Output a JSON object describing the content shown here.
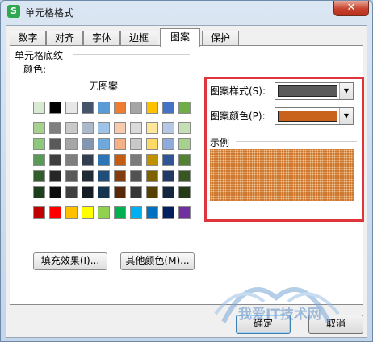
{
  "window": {
    "title": "单元格格式",
    "app_icon_letter": "S",
    "close_glyph": "✕"
  },
  "tabs": [
    {
      "label": "数字",
      "active": false
    },
    {
      "label": "对齐",
      "active": false
    },
    {
      "label": "字体",
      "active": false
    },
    {
      "label": "边框",
      "active": false
    },
    {
      "label": "图案",
      "active": true
    },
    {
      "label": "保护",
      "active": false
    }
  ],
  "shading": {
    "section_title": "单元格底纹",
    "color_label": "颜色:",
    "no_pattern_label": "无图案",
    "palette_rows": [
      [
        "#d9ead3",
        "#000000",
        "#e7e7e7",
        "#44546a",
        "#5b9bd5",
        "#ed7d31",
        "#a5a5a5",
        "#ffc000",
        "#4472c4",
        "#70ad47"
      ],
      [
        "#a9d18e",
        "#7f7f7f",
        "#c9c9c9",
        "#acb9ca",
        "#9dc3e6",
        "#f8cbad",
        "#dbdbdb",
        "#ffe699",
        "#b4c7e7",
        "#c5e0b4"
      ],
      [
        "#8cc97c",
        "#595959",
        "#a6a6a6",
        "#8497b0",
        "#6fa8dc",
        "#f4b183",
        "#c9c9c9",
        "#ffd966",
        "#8faadc",
        "#a9d18e"
      ],
      [
        "#5a9a56",
        "#3f3f3f",
        "#7f7f7f",
        "#333f50",
        "#2e75b6",
        "#c55a11",
        "#7b7b7b",
        "#bf9000",
        "#2f5597",
        "#548235"
      ],
      [
        "#2f5e2c",
        "#262626",
        "#595959",
        "#222a35",
        "#1f4e79",
        "#843c0c",
        "#525252",
        "#7f6000",
        "#203864",
        "#385723"
      ],
      [
        "#1e3f1c",
        "#0d0d0d",
        "#404040",
        "#161c24",
        "#14344f",
        "#582808",
        "#363636",
        "#554000",
        "#14253f",
        "#253a17"
      ]
    ],
    "standard_colors": [
      "#c00000",
      "#ff0000",
      "#ffc000",
      "#ffff00",
      "#92d050",
      "#00b050",
      "#00b0f0",
      "#0070c0",
      "#002060",
      "#7030a0"
    ],
    "fill_effects_button": "填充效果(I)...",
    "more_colors_button": "其他颜色(M)..."
  },
  "pattern": {
    "style_label": "图案样式(S):",
    "color_label": "图案颜色(P):",
    "color_value": "#c9621a",
    "sample_label": "示例"
  },
  "footer": {
    "ok": "确定",
    "cancel": "取消"
  },
  "watermark": {
    "text": "我爱IT技术网"
  }
}
